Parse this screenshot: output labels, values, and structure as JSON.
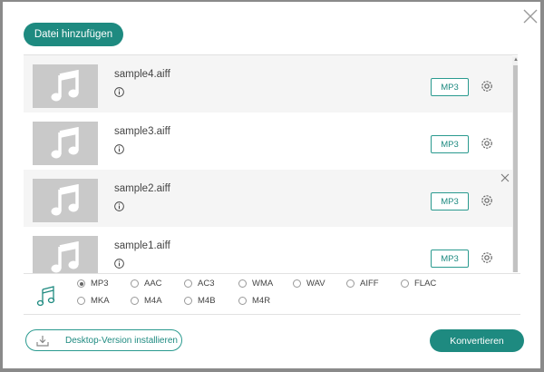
{
  "header": {
    "add_label": "Datei hinzufügen"
  },
  "files": [
    {
      "name": "sample4.aiff",
      "format": "MP3"
    },
    {
      "name": "sample3.aiff",
      "format": "MP3"
    },
    {
      "name": "sample2.aiff",
      "format": "MP3"
    },
    {
      "name": "sample1.aiff",
      "format": "MP3"
    }
  ],
  "formats": {
    "selected": "MP3",
    "row1": [
      "MP3",
      "AAC",
      "AC3",
      "WMA",
      "WAV",
      "AIFF",
      "FLAC"
    ],
    "row2": [
      "MKA",
      "M4A",
      "M4B",
      "M4R"
    ]
  },
  "footer": {
    "install_label": "Desktop-Version installieren",
    "convert_label": "Konvertieren"
  },
  "colors": {
    "accent": "#1e8a80",
    "thumb": "#c9c9c9",
    "row_alt": "#f5f5f5"
  },
  "icons": [
    "close-icon",
    "music-note-icon",
    "info-icon",
    "gear-icon",
    "download-icon"
  ]
}
